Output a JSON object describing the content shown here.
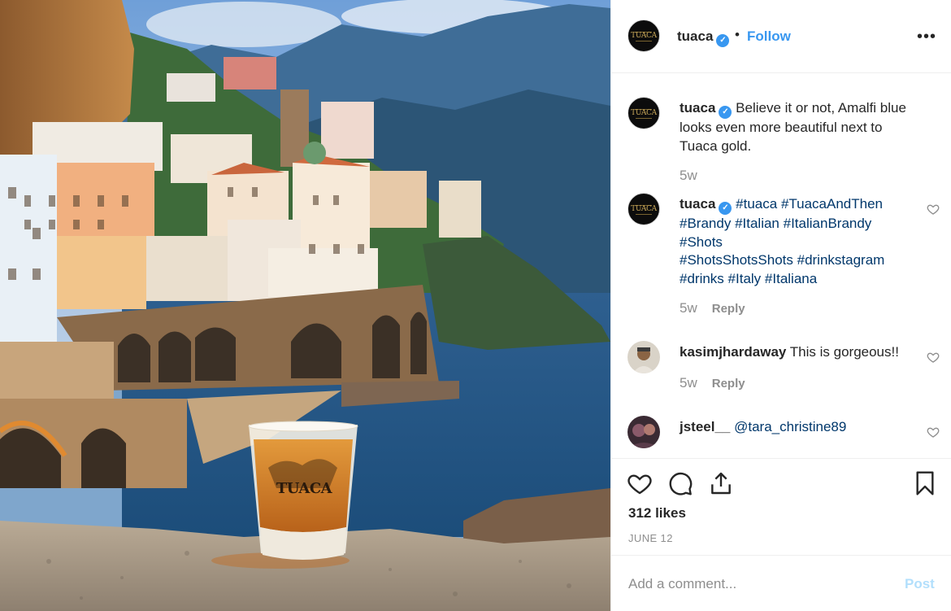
{
  "post": {
    "image_alt": "Tuaca shot glass on a stone ledge overlooking the Amalfi coast",
    "glass_text": "TUACA"
  },
  "header": {
    "username": "tuaca",
    "verified": true,
    "separator": "•",
    "follow_label": "Follow",
    "more_label": "•••",
    "avatar_text": "TUACA"
  },
  "comments": [
    {
      "username": "tuaca",
      "verified": true,
      "text": "Believe it or not, Amalfi blue looks even more beautiful next to Tuaca gold.",
      "time": "5w"
    },
    {
      "username": "tuaca",
      "verified": true,
      "hashtags": [
        "#tuaca",
        "#TuacaAndThen",
        "#Brandy",
        "#Italian",
        "#ItalianBrandy",
        "#Shots",
        "#ShotsShotsShots",
        "#drinkstagram",
        "#drinks",
        "#Italy",
        "#Italiana"
      ],
      "time": "5w",
      "reply_label": "Reply"
    },
    {
      "username": "kasimjhardaway",
      "text": "This is gorgeous!!",
      "time": "5w",
      "reply_label": "Reply"
    },
    {
      "username": "jsteel__",
      "mention": "@tara_christine89"
    }
  ],
  "actions": {
    "like_icon": "heart-icon",
    "comment_icon": "comment-bubble-icon",
    "share_icon": "share-icon",
    "save_icon": "bookmark-icon",
    "likes": "312 likes",
    "date": "JUNE 12"
  },
  "add_comment": {
    "placeholder": "Add a comment...",
    "post_label": "Post"
  },
  "colors": {
    "accent": "#3897f0",
    "hashtag": "#00376b",
    "muted": "#8e8e8e",
    "post_disabled": "#b2dffc"
  }
}
